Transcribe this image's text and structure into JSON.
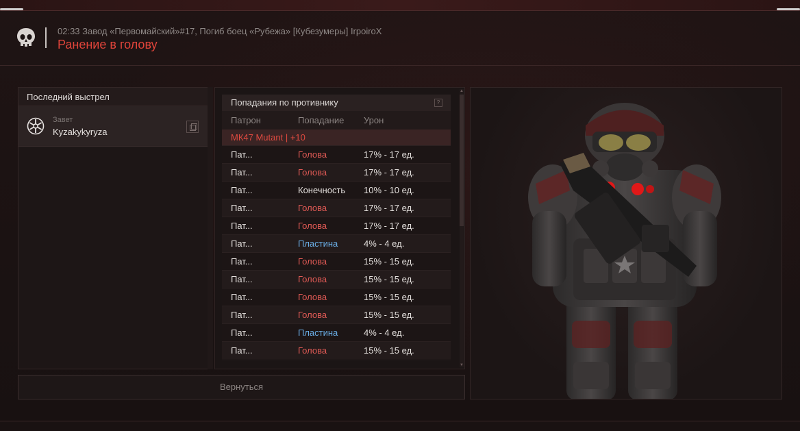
{
  "header": {
    "event_line": "02:33 Завод «Первомайский»#17, Погиб боец «Рубежа» [Кубезумеры] IrpoiroX",
    "event_title": "Ранение в голову"
  },
  "last_shot": {
    "title": "Последний выстрел",
    "faction": "Завет",
    "player_name": "Kyzakykyryza"
  },
  "hits": {
    "title": "Попадания по противнику",
    "columns": {
      "ammo": "Патрон",
      "hit": "Попадание",
      "damage": "Урон"
    },
    "weapon": "МК47 Mutant | +10",
    "rows": [
      {
        "ammo": "Пат...",
        "hit": "Голова",
        "damage": "17% - 17 ед.",
        "type": "head"
      },
      {
        "ammo": "Пат...",
        "hit": "Голова",
        "damage": "17% - 17 ед.",
        "type": "head"
      },
      {
        "ammo": "Пат...",
        "hit": "Конечность",
        "damage": "10% - 10 ед.",
        "type": "limb"
      },
      {
        "ammo": "Пат...",
        "hit": "Голова",
        "damage": "17% - 17 ед.",
        "type": "head"
      },
      {
        "ammo": "Пат...",
        "hit": "Голова",
        "damage": "17% - 17 ед.",
        "type": "head"
      },
      {
        "ammo": "Пат...",
        "hit": "Пластина",
        "damage": "4% - 4 ед.",
        "type": "plate"
      },
      {
        "ammo": "Пат...",
        "hit": "Голова",
        "damage": "15% - 15 ед.",
        "type": "head"
      },
      {
        "ammo": "Пат...",
        "hit": "Голова",
        "damage": "15% - 15 ед.",
        "type": "head"
      },
      {
        "ammo": "Пат...",
        "hit": "Голова",
        "damage": "15% - 15 ед.",
        "type": "head"
      },
      {
        "ammo": "Пат...",
        "hit": "Голова",
        "damage": "15% - 15 ед.",
        "type": "head"
      },
      {
        "ammo": "Пат...",
        "hit": "Пластина",
        "damage": "4% - 4 ед.",
        "type": "plate"
      },
      {
        "ammo": "Пат...",
        "hit": "Голова",
        "damage": "15% - 15 ед.",
        "type": "head"
      }
    ]
  },
  "back_button": "Вернуться",
  "colors": {
    "accent_red": "#e0443a",
    "head": "#e05a55",
    "plate": "#6aaee6"
  },
  "icons": {
    "header": "skull-icon",
    "faction": "faction-emblem-icon",
    "copy": "copy-icon",
    "help": "help-icon"
  }
}
